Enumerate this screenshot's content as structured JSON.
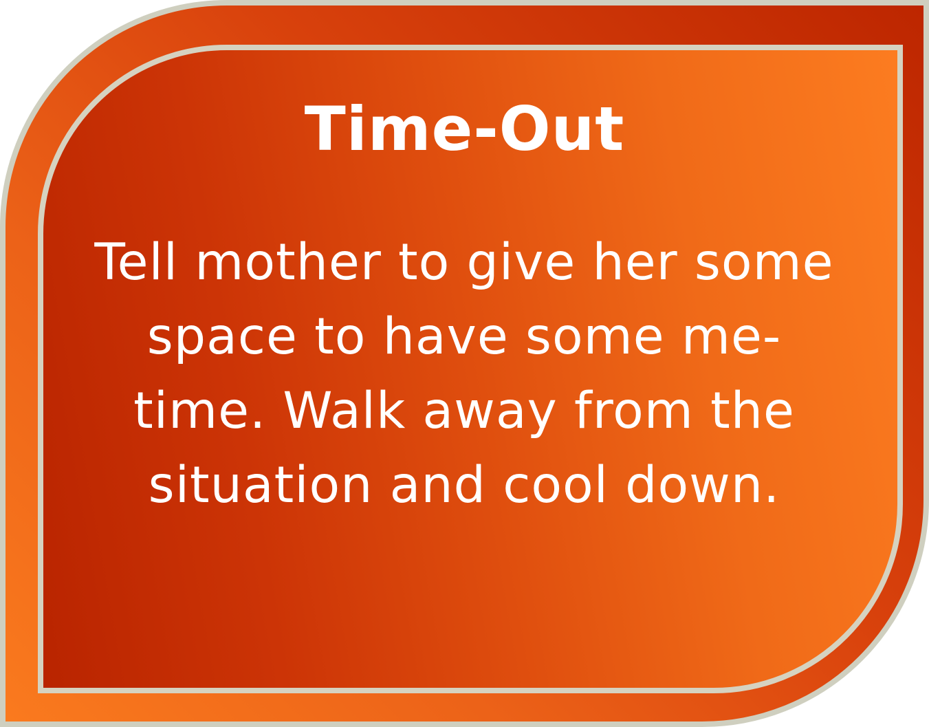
{
  "card": {
    "title": "Time-Out",
    "body": "Tell mother to give her some space to have some me-time. Walk away from the situation and cool down."
  },
  "colors": {
    "outer_border": "#cfcfbf",
    "inner_border": "#d6d2c0",
    "gradient_dark": "#bd2600",
    "gradient_light": "#fc7c20",
    "text": "#ffffff"
  }
}
